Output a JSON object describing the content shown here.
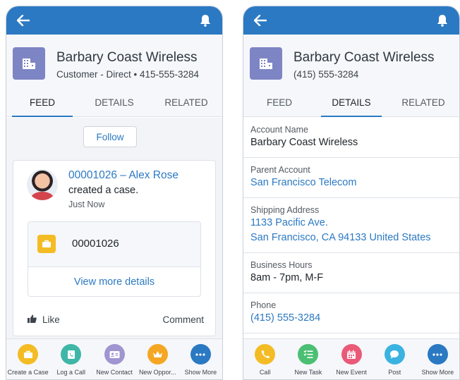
{
  "left": {
    "account_name": "Barbary Coast Wireless",
    "subtitle": "Customer - Direct  •  415-555-3284",
    "tabs": [
      {
        "label": "FEED",
        "active": true
      },
      {
        "label": "DETAILS",
        "active": false
      },
      {
        "label": "RELATED",
        "active": false
      }
    ],
    "follow_label": "Follow",
    "post": {
      "title": "00001026 – Alex Rose",
      "action": "created a case.",
      "time": "Just Now",
      "case_number": "00001026",
      "view_more": "View more details",
      "like_label": "Like",
      "comment_label": "Comment"
    },
    "actions": [
      {
        "label": "Create a Case",
        "icon": "briefcase-icon",
        "color": "#f4bc24"
      },
      {
        "label": "Log a Call",
        "icon": "phone-log-icon",
        "color": "#3fb6a8"
      },
      {
        "label": "New Contact",
        "icon": "contact-card-icon",
        "color": "#a094d1"
      },
      {
        "label": "New Oppor...",
        "icon": "crown-icon",
        "color": "#f5a623"
      },
      {
        "label": "Show More",
        "icon": "more-icon",
        "color": "#2b79c3"
      }
    ]
  },
  "right": {
    "account_name": "Barbary Coast Wireless",
    "subtitle": "(415) 555-3284",
    "tabs": [
      {
        "label": "FEED",
        "active": false
      },
      {
        "label": "DETAILS",
        "active": true
      },
      {
        "label": "RELATED",
        "active": false
      }
    ],
    "fields": [
      {
        "label": "Account Name",
        "value": "Barbary Coast Wireless",
        "link": false
      },
      {
        "label": "Parent Account",
        "value": "San Francisco Telecom",
        "link": true
      },
      {
        "label": "Shipping Address",
        "value": "1133 Pacific Ave.",
        "value2": "San Francisco, CA 94133 United States",
        "link": true
      },
      {
        "label": "Business Hours",
        "value": "8am - 7pm, M-F",
        "link": false
      },
      {
        "label": "Phone",
        "value": "(415) 555-3284",
        "link": true
      }
    ],
    "actions": [
      {
        "label": "Call",
        "icon": "phone-icon",
        "color": "#f4bc24"
      },
      {
        "label": "New Task",
        "icon": "task-list-icon",
        "color": "#4bbf73"
      },
      {
        "label": "New Event",
        "icon": "calendar-icon",
        "color": "#ea5a78"
      },
      {
        "label": "Post",
        "icon": "chat-bubble-icon",
        "color": "#3bb3e0"
      },
      {
        "label": "Show More",
        "icon": "more-icon",
        "color": "#2b79c3"
      }
    ]
  },
  "colors": {
    "brand": "#2b79c3",
    "account_icon": "#7e85c4"
  }
}
